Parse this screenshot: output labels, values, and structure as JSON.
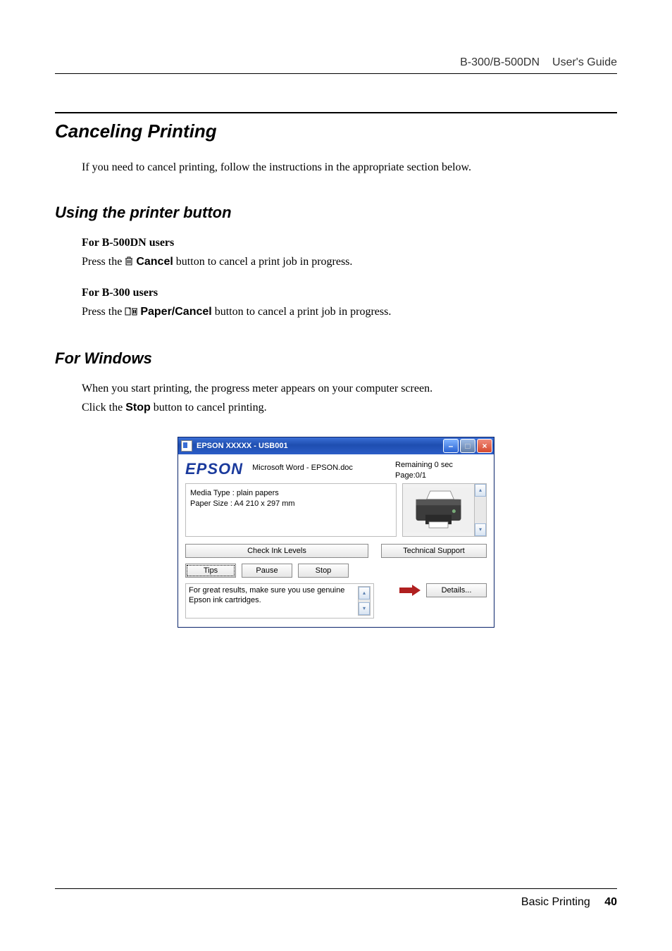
{
  "header": {
    "model": "B-300/B-500DN",
    "doc": "User's Guide"
  },
  "h1": "Canceling Printing",
  "intro": "If you need to cancel printing, follow the instructions in the appropriate section below.",
  "h2a": "Using the printer button",
  "b500": {
    "title": "For B-500DN users",
    "pre": "Press the ",
    "btn": "Cancel",
    "post": " button to cancel a print job in progress."
  },
  "b300": {
    "title": "For B-300 users",
    "pre": "Press the ",
    "btn": "Paper/Cancel",
    "post": " button to cancel a print job in progress."
  },
  "h2b": "For Windows",
  "win_intro": "When you start printing, the progress meter appears on your computer screen.",
  "win_click_pre": "Click the ",
  "win_click_btn": "Stop",
  "win_click_post": " button to cancel printing.",
  "progress": {
    "title": "EPSON  XXXXX  - USB001",
    "logo": "EPSON",
    "docname": "Microsoft Word - EPSON.doc",
    "remaining": "Remaining 0 sec",
    "page": "Page:0/1",
    "media_type": "Media Type : plain papers",
    "paper_size": "Paper Size : A4 210 x 297 mm",
    "buttons": {
      "check_ink": "Check Ink Levels",
      "tech_support": "Technical Support",
      "tips": "Tips",
      "pause": "Pause",
      "stop": "Stop",
      "details": "Details..."
    },
    "tip_text": "For great results, make sure you use genuine Epson ink cartridges."
  },
  "footer": {
    "section": "Basic Printing",
    "page": "40"
  }
}
